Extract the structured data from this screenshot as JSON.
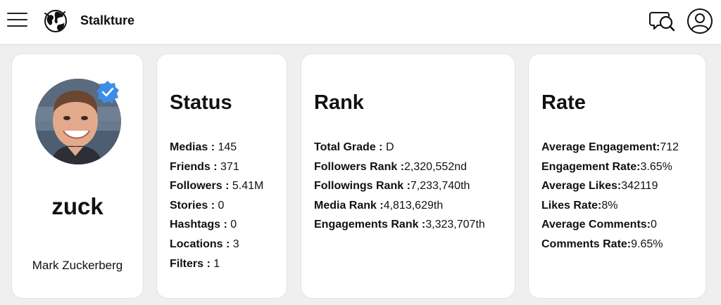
{
  "header": {
    "brand": "Stalkture"
  },
  "profile": {
    "username": "zuck",
    "full_name": "Mark Zuckerberg",
    "verified_color": "#3b8ee8"
  },
  "status": {
    "title": "Status",
    "items": [
      {
        "label": "Medias : ",
        "value": "145"
      },
      {
        "label": "Friends : ",
        "value": "371"
      },
      {
        "label": "Followers : ",
        "value": "5.41M"
      },
      {
        "label": "Stories : ",
        "value": "0"
      },
      {
        "label": "Hashtags : ",
        "value": "0"
      },
      {
        "label": "Locations : ",
        "value": "3"
      },
      {
        "label": "Filters : ",
        "value": "1"
      }
    ]
  },
  "rank": {
    "title": "Rank",
    "items": [
      {
        "label": "Total Grade : ",
        "value": "D"
      },
      {
        "label": "Followers Rank :",
        "value": "2,320,552nd"
      },
      {
        "label": "Followings Rank :",
        "value": "7,233,740th"
      },
      {
        "label": "Media Rank :",
        "value": "4,813,629th"
      },
      {
        "label": "Engagements Rank :",
        "value": "3,323,707th"
      }
    ]
  },
  "rate": {
    "title": "Rate",
    "items": [
      {
        "label": "Average Engagement:",
        "value": "712"
      },
      {
        "label": "Engagement Rate:",
        "value": "3.65%"
      },
      {
        "label": "Average Likes:",
        "value": "342119"
      },
      {
        "label": "Likes Rate:",
        "value": "8%"
      },
      {
        "label": "Average Comments:",
        "value": "0"
      },
      {
        "label": "Comments Rate:",
        "value": "9.65%"
      }
    ]
  }
}
